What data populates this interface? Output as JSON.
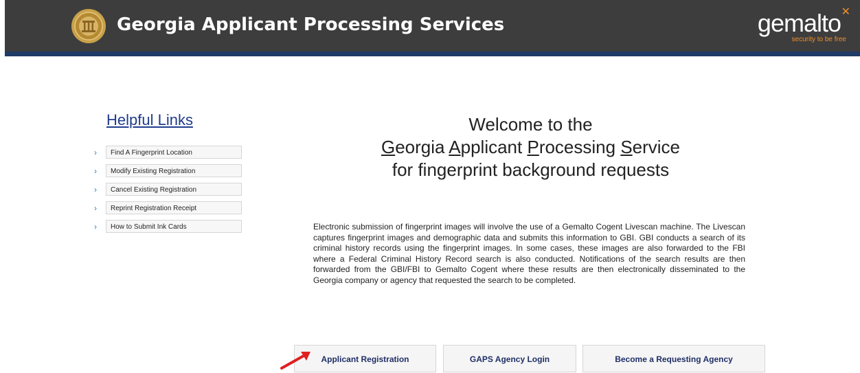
{
  "header": {
    "title": "Georgia Applicant Processing Services",
    "logo_word": "gemalto",
    "logo_tagline": "security to be free",
    "background": "#3d3d3d",
    "accent_bar": "#1f3b66"
  },
  "sidebar": {
    "heading": "Helpful Links",
    "items": [
      {
        "label": "Find A Fingerprint Location"
      },
      {
        "label": "Modify Existing Registration"
      },
      {
        "label": "Cancel Existing Registration"
      },
      {
        "label": "Reprint Registration Receipt"
      },
      {
        "label": "How to Submit Ink Cards"
      }
    ]
  },
  "welcome": {
    "line1": "Welcome to the",
    "line2_parts": [
      "G",
      "eorgia ",
      "A",
      "pplicant ",
      "P",
      "rocessing ",
      "S",
      "ervice"
    ],
    "line3": "for fingerprint background requests"
  },
  "description": "Electronic submission of fingerprint images will involve the use of a Gemalto Cogent Livescan machine. The Livescan captures fingerprint images and demographic data and submits this information to GBI. GBI conducts a search of its criminal history records using the fingerprint images. In some cases, these images are also forwarded to the FBI where a Federal Criminal History Record search is also conducted. Notifications of the search results are then forwarded from the GBI/FBI to Gemalto Cogent where these results are then electronically disseminated to the Georgia company or agency that requested the search to be completed.",
  "buttons": {
    "applicant_registration": "Applicant Registration",
    "agency_login": "GAPS Agency Login",
    "become_agency": "Become a Requesting Agency"
  },
  "icons": {
    "seal": "georgia-state-seal-icon",
    "chevron": "chevron-right-icon",
    "arrow": "red-pointer-arrow-icon"
  }
}
